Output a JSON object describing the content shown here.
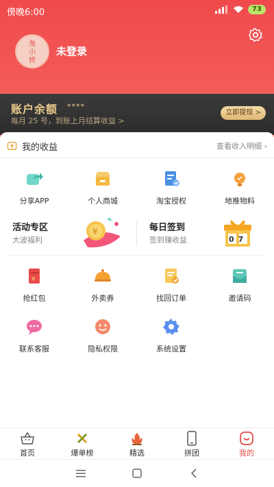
{
  "status_bar": {
    "time": "傍晚6:00",
    "battery": "73"
  },
  "profile": {
    "avatar_text_1": "淘",
    "avatar_text_2": "小",
    "avatar_text_3": "桥",
    "login_label": "未登录"
  },
  "balance": {
    "title": "账户余额",
    "masked": "****",
    "subtitle": "每月 25 号，到账上月结算收益 >",
    "withdraw_label": "立即提现 >"
  },
  "earnings": {
    "label": "我的收益",
    "link": "查看收入明细"
  },
  "grid_row_1": [
    {
      "label": "分享APP",
      "icon": "share-icon"
    },
    {
      "label": "个人商城",
      "icon": "store-icon"
    },
    {
      "label": "淘宝授权",
      "icon": "authorize-icon"
    },
    {
      "label": "地推物料",
      "icon": "bulb-icon"
    }
  ],
  "promo": {
    "activity_title": "活动专区",
    "activity_sub": "大波福利",
    "checkin_title": "每日签到",
    "checkin_sub": "签到赚收益",
    "calendar_digits": "07"
  },
  "grid_row_2": [
    {
      "label": "抢红包",
      "icon": "red-packet-icon"
    },
    {
      "label": "外卖券",
      "icon": "food-cover-icon"
    },
    {
      "label": "找回订单",
      "icon": "order-icon"
    },
    {
      "label": "邀请码",
      "icon": "invite-icon"
    }
  ],
  "grid_row_3": [
    {
      "label": "联系客服",
      "icon": "chat-icon"
    },
    {
      "label": "隐私权限",
      "icon": "privacy-icon"
    },
    {
      "label": "系统设置",
      "icon": "settings-icon"
    }
  ],
  "tabs": [
    {
      "label": "首页",
      "icon": "home-basket-icon"
    },
    {
      "label": "爆单榜",
      "icon": "crossed-icon"
    },
    {
      "label": "精选",
      "icon": "fire-icon"
    },
    {
      "label": "拼团",
      "icon": "phone-icon"
    },
    {
      "label": "我的",
      "icon": "smile-icon",
      "active": true
    }
  ],
  "colors": {
    "header": "#f04a4c",
    "accent": "#e64b49",
    "gold": "#e8c98c",
    "balance_bg": "#333333"
  }
}
